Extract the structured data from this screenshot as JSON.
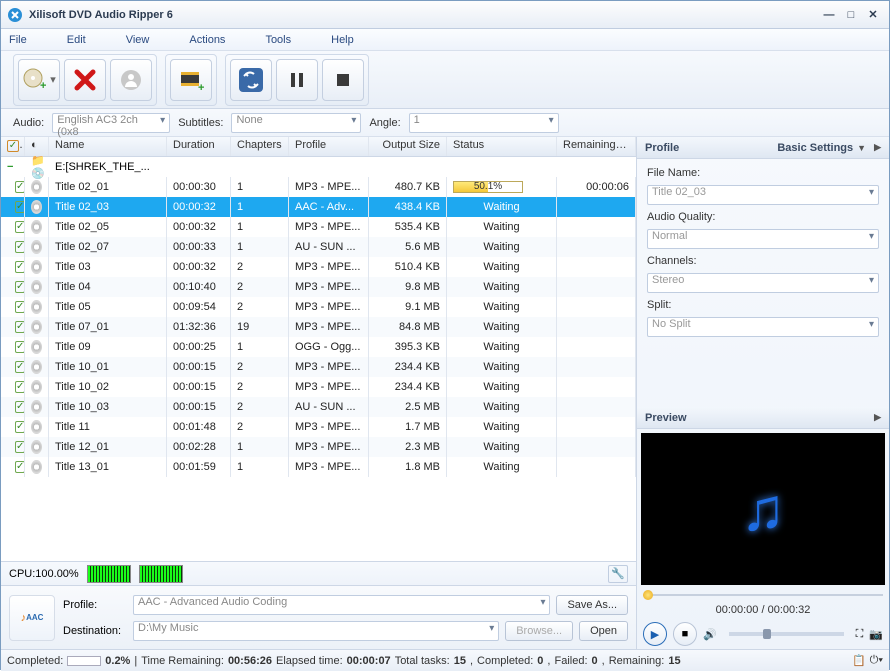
{
  "window": {
    "title": "Xilisoft DVD Audio Ripper 6"
  },
  "menu": {
    "file": "File",
    "edit": "Edit",
    "view": "View",
    "actions": "Actions",
    "tools": "Tools",
    "help": "Help"
  },
  "filters": {
    "audio_label": "Audio:",
    "audio_value": "English AC3 2ch (0x8",
    "subtitles_label": "Subtitles:",
    "subtitles_value": "None",
    "angle_label": "Angle:",
    "angle_value": "1"
  },
  "columns": {
    "name": "Name",
    "duration": "Duration",
    "chapters": "Chapters",
    "profile": "Profile",
    "output_size": "Output Size",
    "status": "Status",
    "remaining": "Remaining Time"
  },
  "source": {
    "label": "E:[SHREK_THE_..."
  },
  "rows": [
    {
      "name": "Title 02_01",
      "duration": "00:00:30",
      "chapters": "1",
      "profile": "MP3 - MPE...",
      "size": "480.7 KB",
      "status_pct": 50.1,
      "status_text": "50.1%",
      "remaining": "00:00:06",
      "selected": false,
      "progress": true
    },
    {
      "name": "Title 02_03",
      "duration": "00:00:32",
      "chapters": "1",
      "profile": "AAC - Adv...",
      "size": "438.4 KB",
      "status_text": "Waiting",
      "remaining": "",
      "selected": true
    },
    {
      "name": "Title 02_05",
      "duration": "00:00:32",
      "chapters": "1",
      "profile": "MP3 - MPE...",
      "size": "535.4 KB",
      "status_text": "Waiting",
      "remaining": "",
      "selected": false
    },
    {
      "name": "Title 02_07",
      "duration": "00:00:33",
      "chapters": "1",
      "profile": "AU - SUN ...",
      "size": "5.6 MB",
      "status_text": "Waiting",
      "remaining": "",
      "selected": false
    },
    {
      "name": "Title 03",
      "duration": "00:00:32",
      "chapters": "2",
      "profile": "MP3 - MPE...",
      "size": "510.4 KB",
      "status_text": "Waiting",
      "remaining": "",
      "selected": false
    },
    {
      "name": "Title 04",
      "duration": "00:10:40",
      "chapters": "2",
      "profile": "MP3 - MPE...",
      "size": "9.8 MB",
      "status_text": "Waiting",
      "remaining": "",
      "selected": false
    },
    {
      "name": "Title 05",
      "duration": "00:09:54",
      "chapters": "2",
      "profile": "MP3 - MPE...",
      "size": "9.1 MB",
      "status_text": "Waiting",
      "remaining": "",
      "selected": false
    },
    {
      "name": "Title 07_01",
      "duration": "01:32:36",
      "chapters": "19",
      "profile": "MP3 - MPE...",
      "size": "84.8 MB",
      "status_text": "Waiting",
      "remaining": "",
      "selected": false
    },
    {
      "name": "Title 09",
      "duration": "00:00:25",
      "chapters": "1",
      "profile": "OGG - Ogg...",
      "size": "395.3 KB",
      "status_text": "Waiting",
      "remaining": "",
      "selected": false
    },
    {
      "name": "Title 10_01",
      "duration": "00:00:15",
      "chapters": "2",
      "profile": "MP3 - MPE...",
      "size": "234.4 KB",
      "status_text": "Waiting",
      "remaining": "",
      "selected": false
    },
    {
      "name": "Title 10_02",
      "duration": "00:00:15",
      "chapters": "2",
      "profile": "MP3 - MPE...",
      "size": "234.4 KB",
      "status_text": "Waiting",
      "remaining": "",
      "selected": false
    },
    {
      "name": "Title 10_03",
      "duration": "00:00:15",
      "chapters": "2",
      "profile": "AU - SUN ...",
      "size": "2.5 MB",
      "status_text": "Waiting",
      "remaining": "",
      "selected": false
    },
    {
      "name": "Title 11",
      "duration": "00:01:48",
      "chapters": "2",
      "profile": "MP3 - MPE...",
      "size": "1.7 MB",
      "status_text": "Waiting",
      "remaining": "",
      "selected": false
    },
    {
      "name": "Title 12_01",
      "duration": "00:02:28",
      "chapters": "1",
      "profile": "MP3 - MPE...",
      "size": "2.3 MB",
      "status_text": "Waiting",
      "remaining": "",
      "selected": false
    },
    {
      "name": "Title 13_01",
      "duration": "00:01:59",
      "chapters": "1",
      "profile": "MP3 - MPE...",
      "size": "1.8 MB",
      "status_text": "Waiting",
      "remaining": "",
      "selected": false
    }
  ],
  "cpu": {
    "label": "CPU:100.00%"
  },
  "bottom": {
    "profile_label": "Profile:",
    "profile_value": "AAC - Advanced Audio Coding",
    "dest_label": "Destination:",
    "dest_value": "D:\\My Music",
    "saveas": "Save As...",
    "browse": "Browse...",
    "open": "Open"
  },
  "status": {
    "completed_label": "Completed:",
    "completed_pct": "0.2%",
    "time_remaining_label": "Time Remaining:",
    "time_remaining": "00:56:26",
    "elapsed_label": "Elapsed time:",
    "elapsed": "00:00:07",
    "tasks_label": "Total tasks:",
    "tasks": "15",
    "tcompleted_label": "Completed:",
    "tcompleted": "0",
    "failed_label": "Failed:",
    "failed": "0",
    "remaining_label": "Remaining:",
    "remaining": "15"
  },
  "profile_panel": {
    "title": "Profile",
    "basic": "Basic Settings",
    "filename_label": "File Name:",
    "filename_value": "Title 02_03",
    "quality_label": "Audio Quality:",
    "quality_value": "Normal",
    "channels_label": "Channels:",
    "channels_value": "Stereo",
    "split_label": "Split:",
    "split_value": "No Split"
  },
  "preview": {
    "title": "Preview",
    "time": "00:00:00 / 00:00:32"
  }
}
